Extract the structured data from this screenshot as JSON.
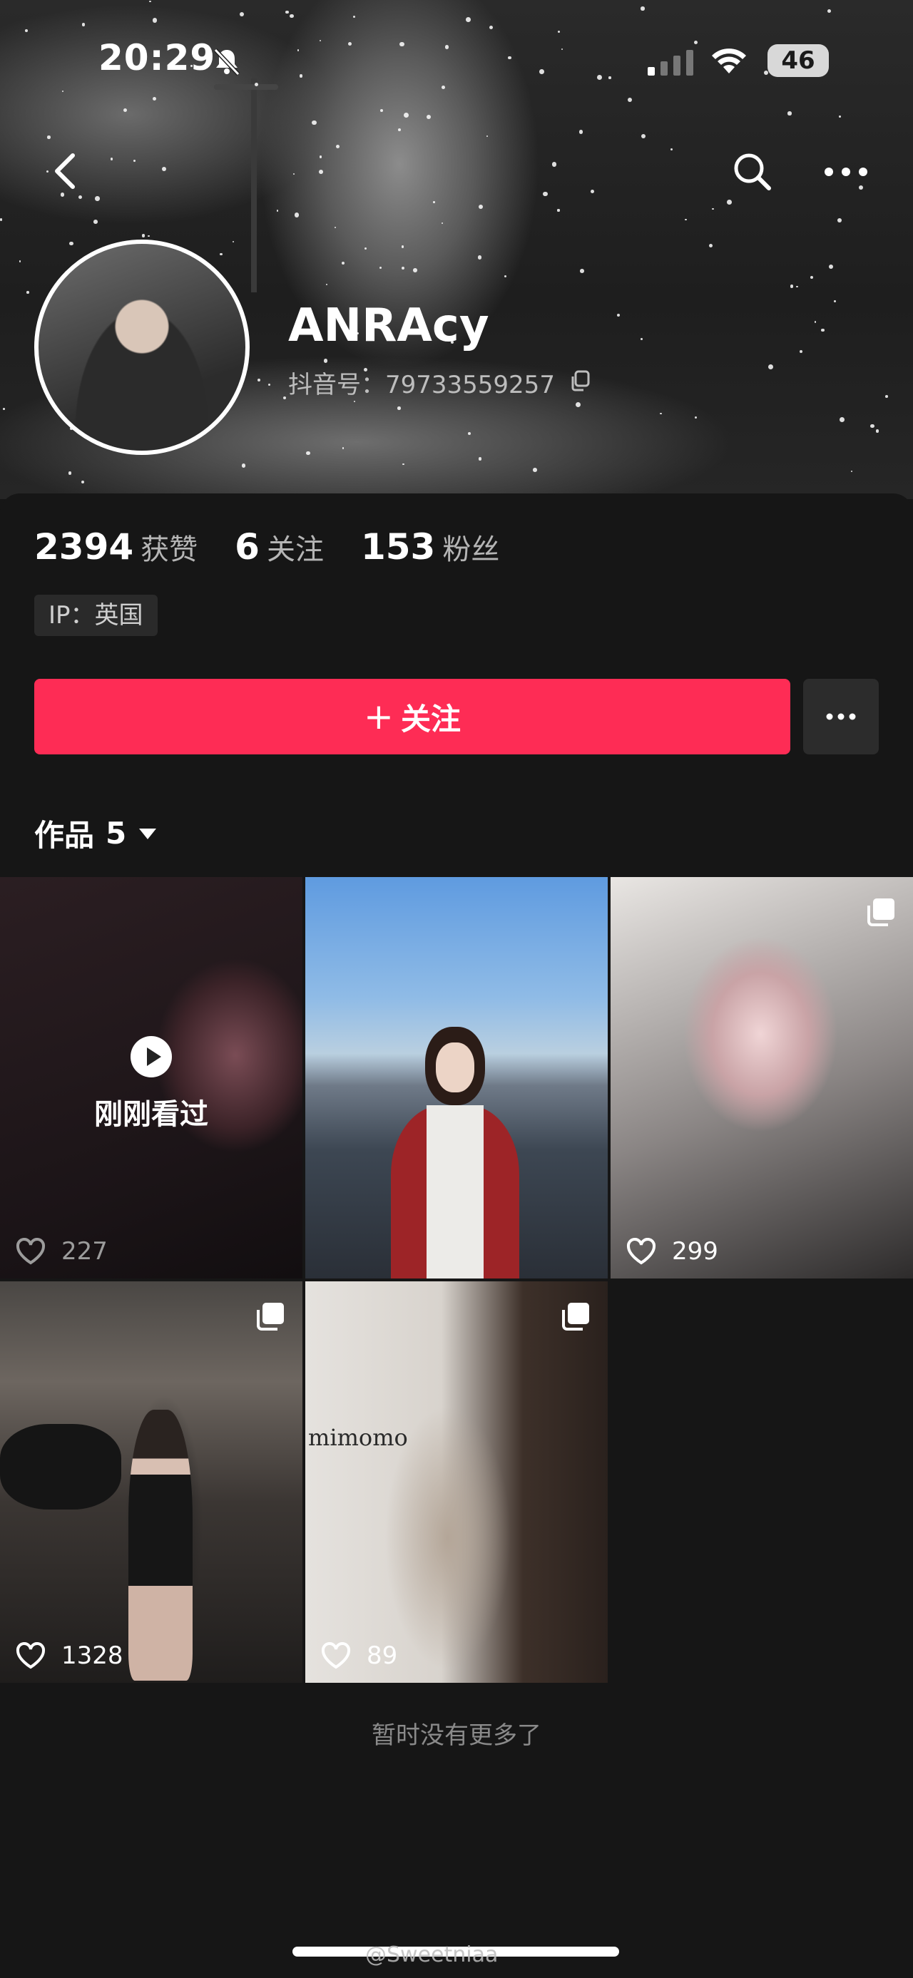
{
  "status_bar": {
    "time": "20:29",
    "battery": "46"
  },
  "profile": {
    "nickname": "ANRAcy",
    "douyin_id": "抖音号：79733559257",
    "stats": [
      {
        "value": "2394",
        "label": "获赞"
      },
      {
        "value": "6",
        "label": "关注"
      },
      {
        "value": "153",
        "label": "粉丝"
      }
    ],
    "ip": "IP：英国"
  },
  "actions": {
    "follow_label": "关注",
    "follow_plus": "+"
  },
  "works_tab": {
    "label": "作品",
    "count": "5"
  },
  "works": [
    {
      "likes": "227",
      "overlay": "刚刚看过",
      "multi": false
    },
    {
      "likes": "",
      "multi": false
    },
    {
      "likes": "299",
      "multi": true
    },
    {
      "likes": "1328",
      "multi": true
    },
    {
      "likes": "89",
      "multi": true,
      "sign_text": "mimomo"
    }
  ],
  "footer": {
    "no_more": "暂时没有更多了",
    "watermark": "@Sweetniaa"
  },
  "colors": {
    "accent": "#fe2c55",
    "background": "#161616"
  }
}
